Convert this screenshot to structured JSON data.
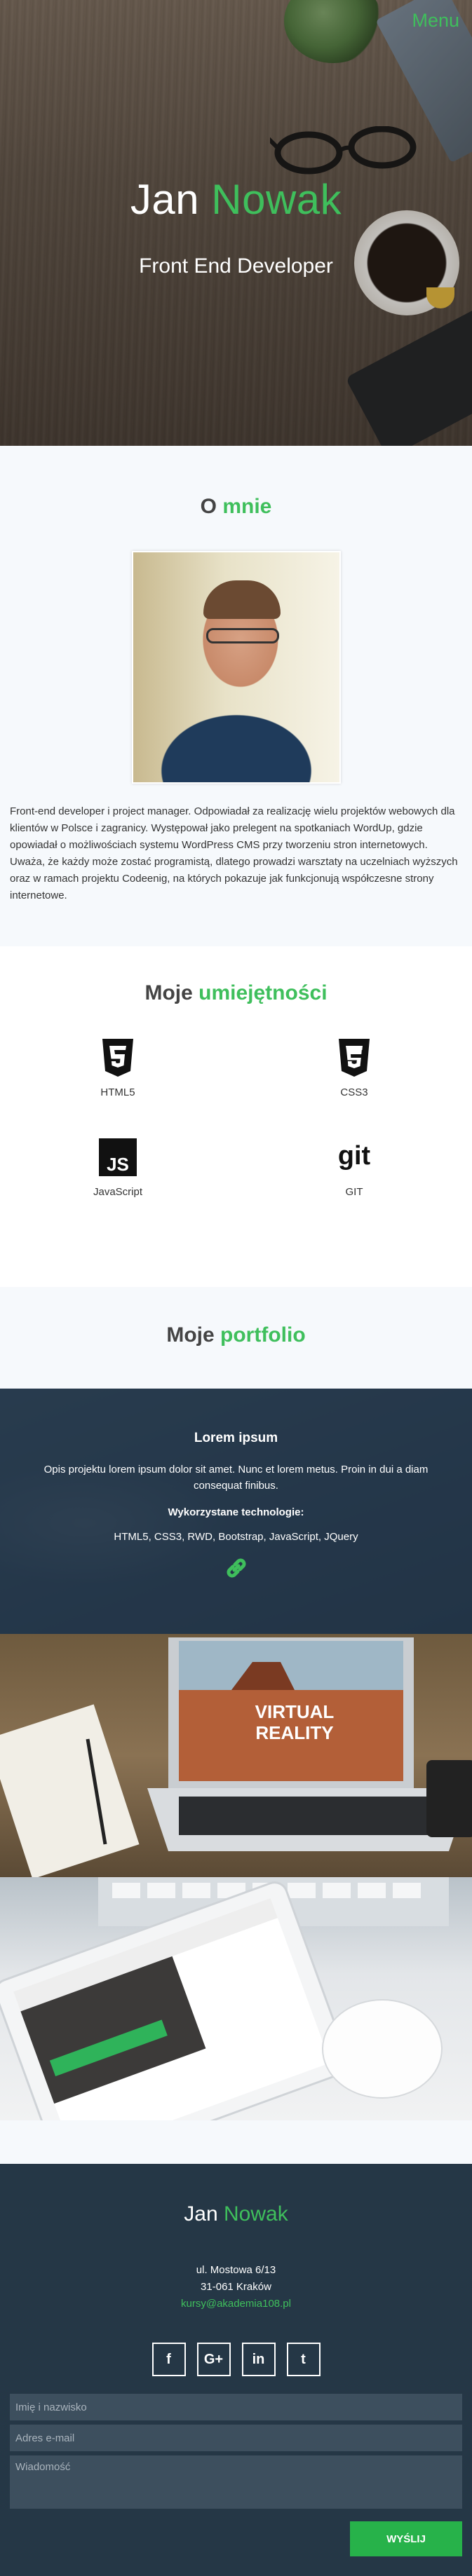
{
  "nav": {
    "menu_label": "Menu"
  },
  "hero": {
    "first_name": "Jan",
    "last_name": "Nowak",
    "subtitle": "Front End Developer"
  },
  "about": {
    "title_plain": "O",
    "title_accent": "mnie",
    "text": "Front-end developer i project manager. Odpowiadał za realizację wielu projektów webowych dla klientów w Polsce i zagranicy. Występował jako prelegent na spotkaniach WordUp, gdzie opowiadał o możliwościach systemu WordPress CMS przy tworzeniu stron internetowych. Uważa, że każdy może zostać programistą, dlatego prowadzi warsztaty na uczelniach wyższych oraz w ramach projektu Codeenig, na których pokazuje jak funkcjonują współczesne strony internetowe."
  },
  "skills": {
    "title_plain": "Moje",
    "title_accent": "umiejętności",
    "items": [
      {
        "label": "HTML5",
        "icon": "html5-icon"
      },
      {
        "label": "CSS3",
        "icon": "css3-icon"
      },
      {
        "label": "JavaScript",
        "icon": "javascript-icon"
      },
      {
        "label": "GIT",
        "icon": "git-icon"
      }
    ]
  },
  "portfolio": {
    "title_plain": "Moje",
    "title_accent": "portfolio",
    "project": {
      "title": "Lorem ipsum",
      "description": "Opis projektu lorem ipsum dolor sit amet. Nunc et lorem metus. Proin in dui a diam consequat finibus.",
      "tech_heading": "Wykorzystane technologie:",
      "tech_list": "HTML5, CSS3, RWD, Bootstrap, JavaScript, JQuery"
    }
  },
  "footer": {
    "first_name": "Jan",
    "last_name": "Nowak",
    "street": "ul. Mostowa 6/13",
    "city": "31-061 Kraków",
    "email": "kursy@akademia108.pl",
    "socials": [
      "f",
      "G+",
      "in",
      "t"
    ],
    "form": {
      "name_placeholder": "Imię i nazwisko",
      "email_placeholder": "Adres e-mail",
      "message_placeholder": "Wiadomość",
      "submit_label": "WYŚLIJ"
    }
  },
  "colors": {
    "accent": "#3fbf5c",
    "footer_bg": "#253746",
    "button": "#27b24a"
  }
}
